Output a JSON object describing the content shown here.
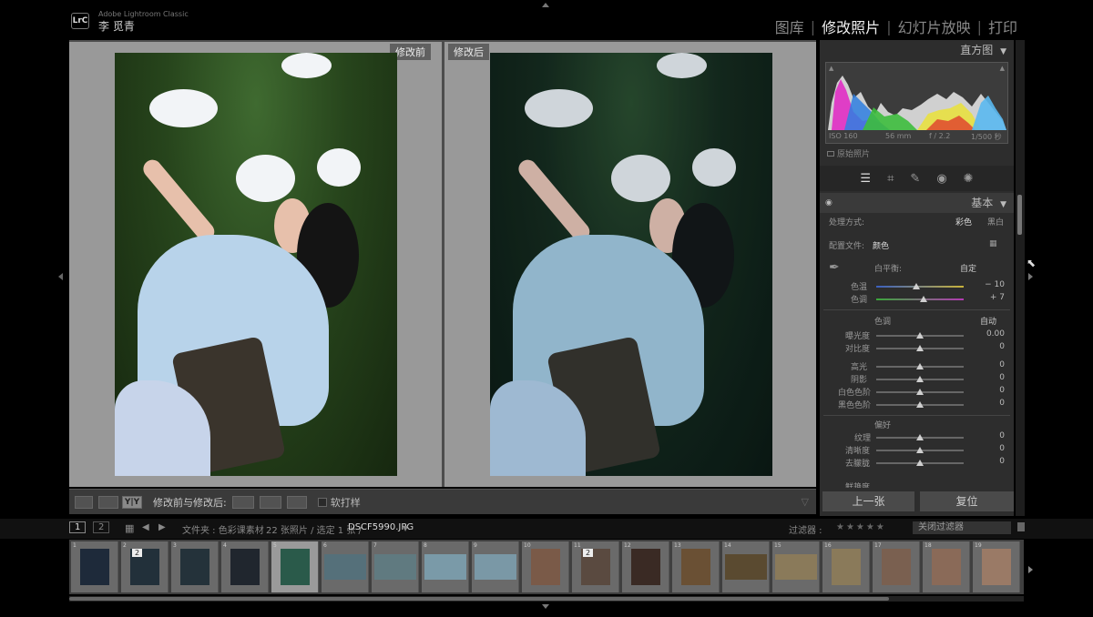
{
  "app": {
    "badge": "LrC",
    "subtitle": "Adobe Lightroom Classic",
    "user": "李 觅青"
  },
  "modules": {
    "library": "图库",
    "develop": "修改照片",
    "slideshow": "幻灯片放映",
    "print": "打印",
    "separator": "|"
  },
  "compare": {
    "before_label": "修改前",
    "after_label": "修改后"
  },
  "toolbar": {
    "view_yy": "Y|Y",
    "before_after_label": "修改前与修改后:",
    "soft_proof": "软打样"
  },
  "panel": {
    "histogram_title": "直方图",
    "exif": {
      "iso": "ISO 160",
      "focal": "56 mm",
      "aperture": "f / 2.2",
      "shutter": "1/500 秒"
    },
    "original_photo": "原始照片",
    "basic_title": "基本",
    "treatment_label": "处理方式:",
    "treatment_color": "彩色",
    "treatment_bw": "黑白",
    "profile_label": "配置文件:",
    "profile_value": "颜色",
    "wb_label": "白平衡:",
    "wb_value": "自定",
    "temp_label": "色温",
    "temp_value": "− 10",
    "tint_label": "色调",
    "tint_value": "+ 7",
    "tone_label": "色调",
    "tone_auto": "自动",
    "exposure_label": "曝光度",
    "exposure_value": "0.00",
    "contrast_label": "对比度",
    "contrast_value": "0",
    "highlights_label": "高光",
    "highlights_value": "0",
    "shadows_label": "阴影",
    "shadows_value": "0",
    "whites_label": "白色色阶",
    "whites_value": "0",
    "blacks_label": "黑色色阶",
    "blacks_value": "0",
    "presence_label": "偏好",
    "texture_label": "纹理",
    "texture_value": "0",
    "clarity_label": "清晰度",
    "clarity_value": "0",
    "dehaze_label": "去朦胧",
    "dehaze_value": "0",
    "vibrance_label": "鲜艳度",
    "prev_button": "上一张",
    "reset_button": "复位"
  },
  "filmstrip_bar": {
    "page1": "1",
    "page2": "2",
    "folder": "文件夹 : 色彩课素材",
    "count": "22 张照片 / 选定 1 张 /",
    "filename": "DSCF5990.JPG",
    "filter_label": "过滤器 :",
    "filter_value": "关闭过滤器"
  },
  "filmstrip": {
    "selected_index": 4,
    "numbers": [
      "1",
      "2",
      "3",
      "4",
      "5",
      "6",
      "7",
      "8",
      "9",
      "10",
      "11",
      "12",
      "13",
      "14",
      "15",
      "16",
      "17",
      "18",
      "19"
    ],
    "stack_badge": "2"
  },
  "colors": {
    "accent": "#eeeeee",
    "panel_bg": "#2d2d2d",
    "view_bg": "#999999"
  }
}
